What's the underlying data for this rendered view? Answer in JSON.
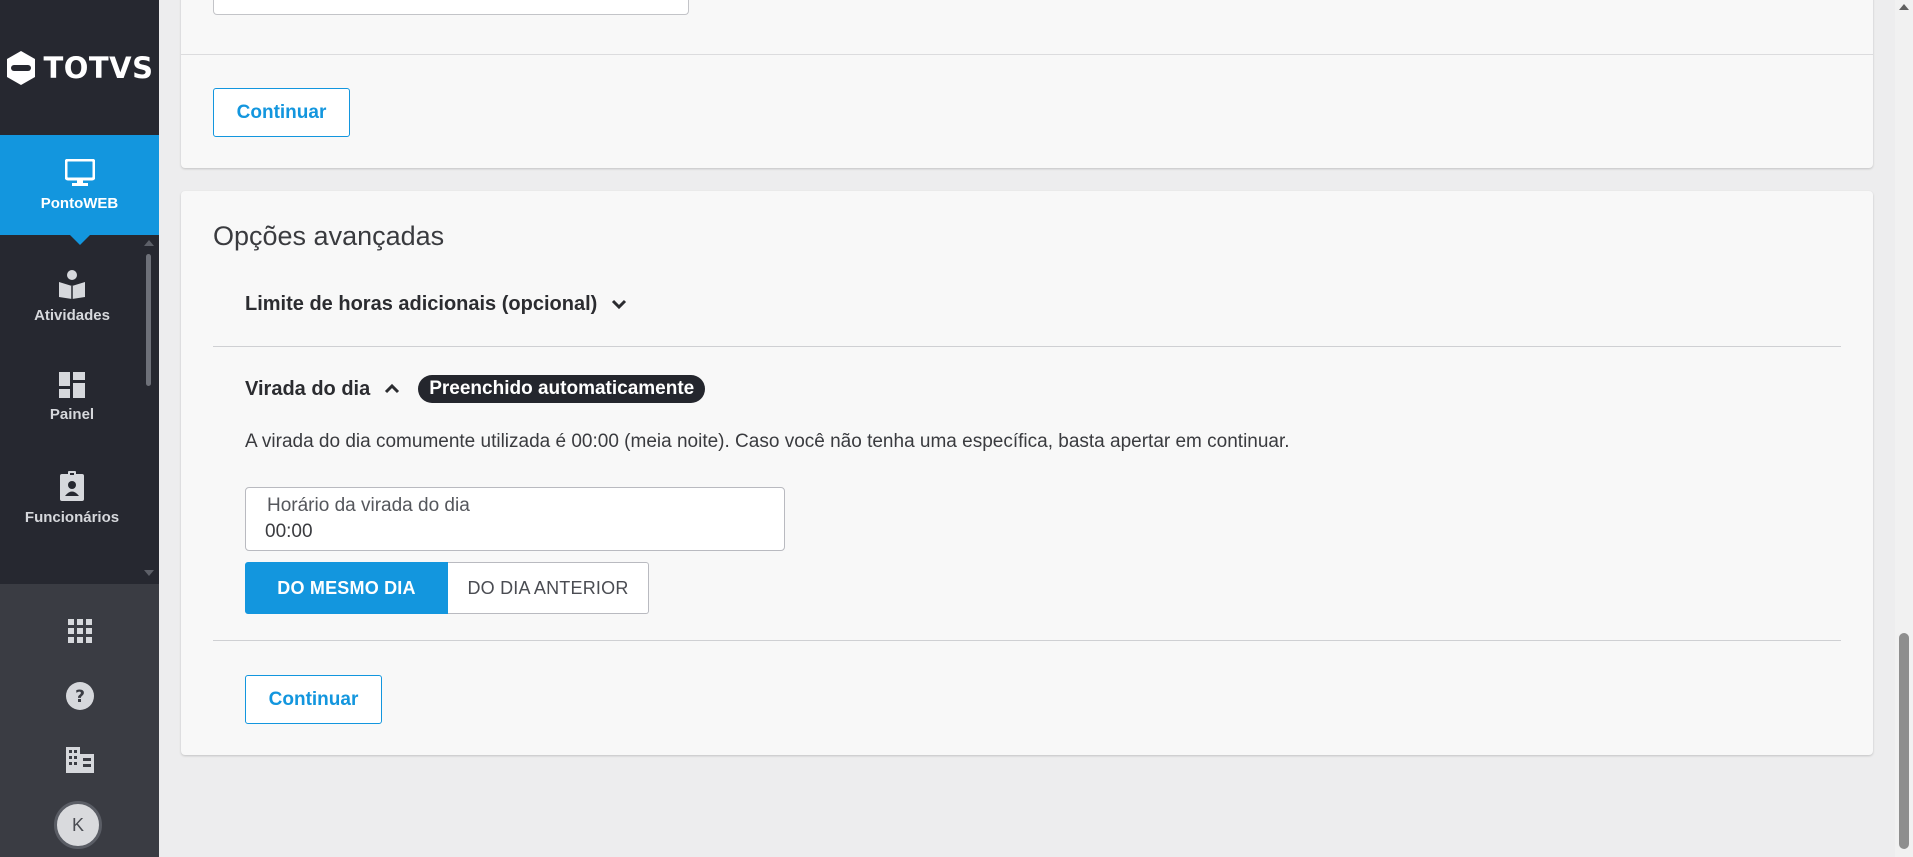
{
  "sidebar": {
    "logo_text": "TOTVS",
    "items": [
      {
        "label": "PontoWEB",
        "icon": "monitor-icon",
        "active": true
      },
      {
        "label": "Atividades",
        "icon": "book-person-icon",
        "active": false
      },
      {
        "label": "Painel",
        "icon": "dashboard-icon",
        "active": false
      },
      {
        "label": "Funcionários",
        "icon": "badge-icon",
        "active": false
      }
    ],
    "bottom_icons": [
      "apps-grid-icon",
      "help-icon",
      "company-building-icon"
    ],
    "avatar_initial": "K"
  },
  "top_card": {
    "continue_label": "Continuar"
  },
  "advanced": {
    "title": "Opções avançadas",
    "limite": {
      "label": "Limite de horas adicionais (opcional)",
      "expanded": false
    },
    "virada": {
      "label": "Virada do dia",
      "expanded": true,
      "badge": "Preenchido automaticamente",
      "help_text": "A virada do dia comumente utilizada é 00:00 (meia noite). Caso você não tenha uma específica, basta apertar em continuar.",
      "field_label": "Horário da virada do dia",
      "field_value": "00:00",
      "options": [
        {
          "label": "DO MESMO DIA",
          "selected": true
        },
        {
          "label": "DO DIA ANTERIOR",
          "selected": false
        }
      ]
    },
    "continue_label": "Continuar"
  },
  "colors": {
    "accent": "#1396de",
    "sidebar_bg": "#262830",
    "sidebar_bottom_bg": "#3a3c43",
    "badge_bg": "#24262d"
  }
}
